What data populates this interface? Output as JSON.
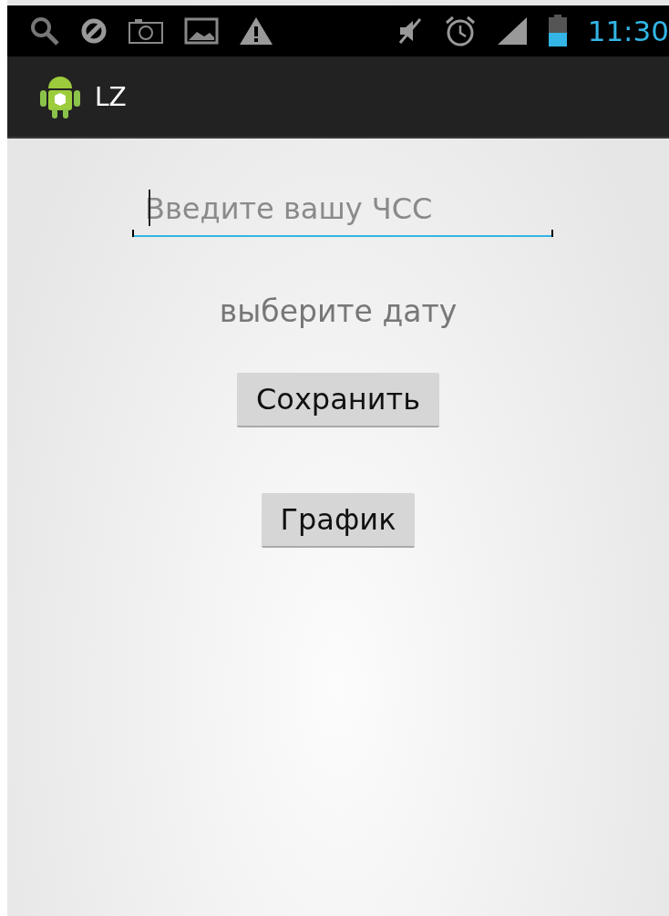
{
  "status_bar": {
    "time": "11:30"
  },
  "action_bar": {
    "title": "LZ"
  },
  "hr_field": {
    "placeholder": "Введите вашу ЧСС",
    "focused": true
  },
  "date_label": "выберите дату",
  "buttons": [
    "Сохранить",
    "График"
  ]
}
